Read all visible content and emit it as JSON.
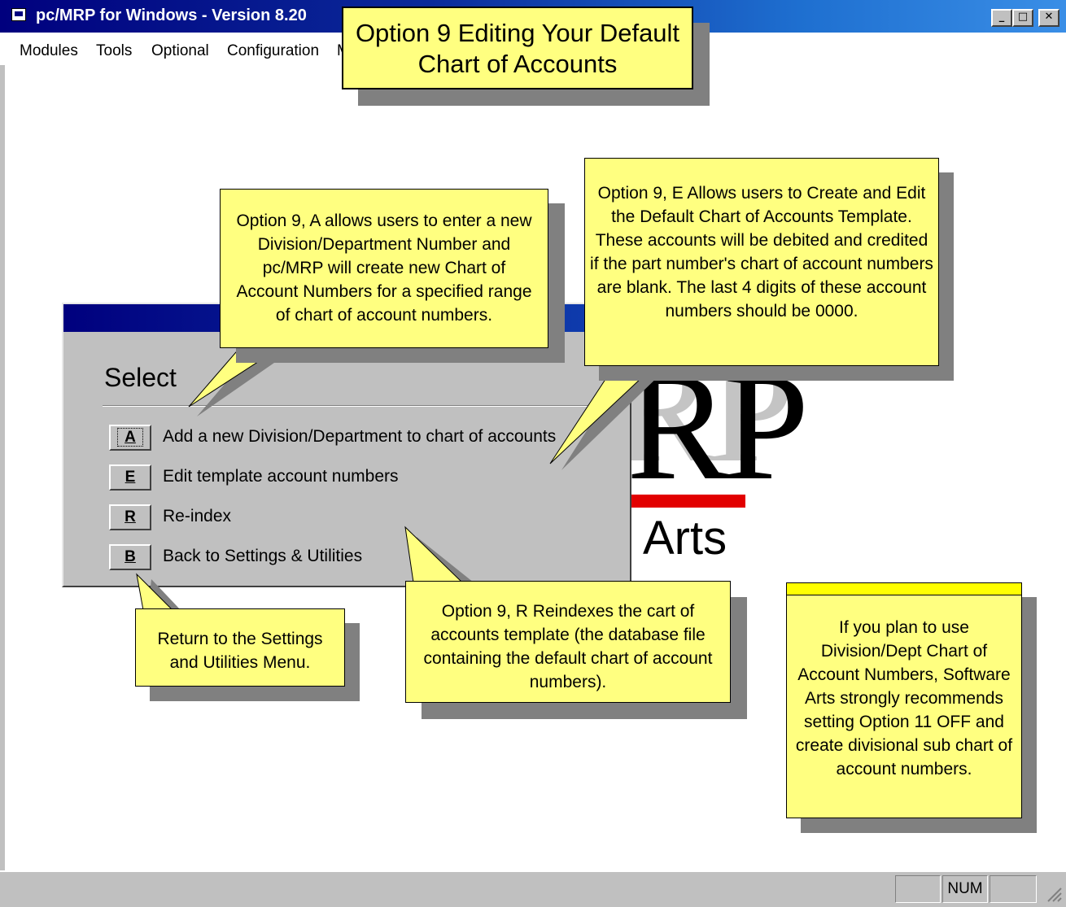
{
  "window": {
    "title": "pc/MRP for Windows - Version 8.20",
    "minimize_icon": "minimize-icon",
    "maximize_icon": "maximize-icon",
    "close_icon": "close-icon"
  },
  "menubar": {
    "items": [
      "Modules",
      "Tools",
      "Optional",
      "Configuration",
      "M"
    ]
  },
  "logo": {
    "letters": "RP",
    "word": "Arts"
  },
  "dialog": {
    "heading": "Select",
    "options": [
      {
        "key": "A",
        "label": "Add a new Division/Department to chart of accounts"
      },
      {
        "key": "E",
        "label": "Edit template account numbers"
      },
      {
        "key": "R",
        "label": "Re-index"
      },
      {
        "key": "B",
        "label": "Back to Settings & Utilities"
      }
    ]
  },
  "callouts": {
    "title": "Option 9 Editing Your Default Chart of Accounts",
    "option_a": "Option 9, A allows users to enter  a new Division/Department Number and pc/MRP will create new Chart of Account Numbers for a specified range of chart of account numbers.",
    "option_e": "Option 9, E Allows users to Create and Edit the Default Chart of Accounts Template.   These accounts will be debited and credited if the part number's chart of account numbers are blank.  The last 4 digits of these account numbers should be 0000.",
    "option_r": "Option 9, R Reindexes the cart of accounts template (the database file containing the default chart of account numbers).",
    "option_b": "Return to the Settings and Utilities Menu.",
    "note": "If you plan to use Division/Dept Chart of Account Numbers, Software Arts strongly recommends setting Option 11 OFF and create divisional sub chart of account numbers."
  },
  "statusbar": {
    "num": "NUM"
  },
  "colors": {
    "callout_fill": "#ffff80",
    "note_header": "#ffff00",
    "titlebar": "#00007e",
    "logo_bar": "#e20000"
  }
}
